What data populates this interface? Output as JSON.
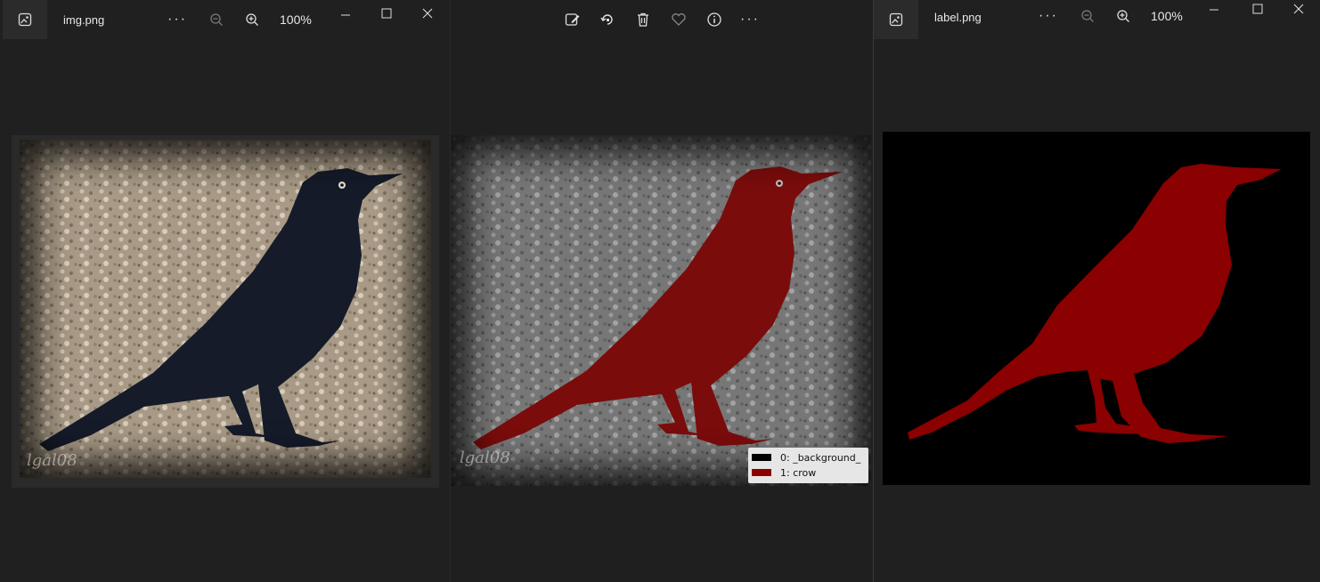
{
  "left_window": {
    "filename": "img.png",
    "zoom": "100%",
    "more": "···",
    "watermark": "lgal08"
  },
  "middle_window": {
    "more": "···",
    "watermark": "lgal08",
    "legend": [
      {
        "label": "0: _background_",
        "color": "#000000"
      },
      {
        "label": "1: crow",
        "color": "#8b0000"
      }
    ]
  },
  "right_window": {
    "filename": "label.png",
    "zoom": "100%",
    "more": "···"
  },
  "colors": {
    "app_bg": "#202020",
    "mask_red": "#8b0000",
    "crow_dark": "#151b29"
  }
}
